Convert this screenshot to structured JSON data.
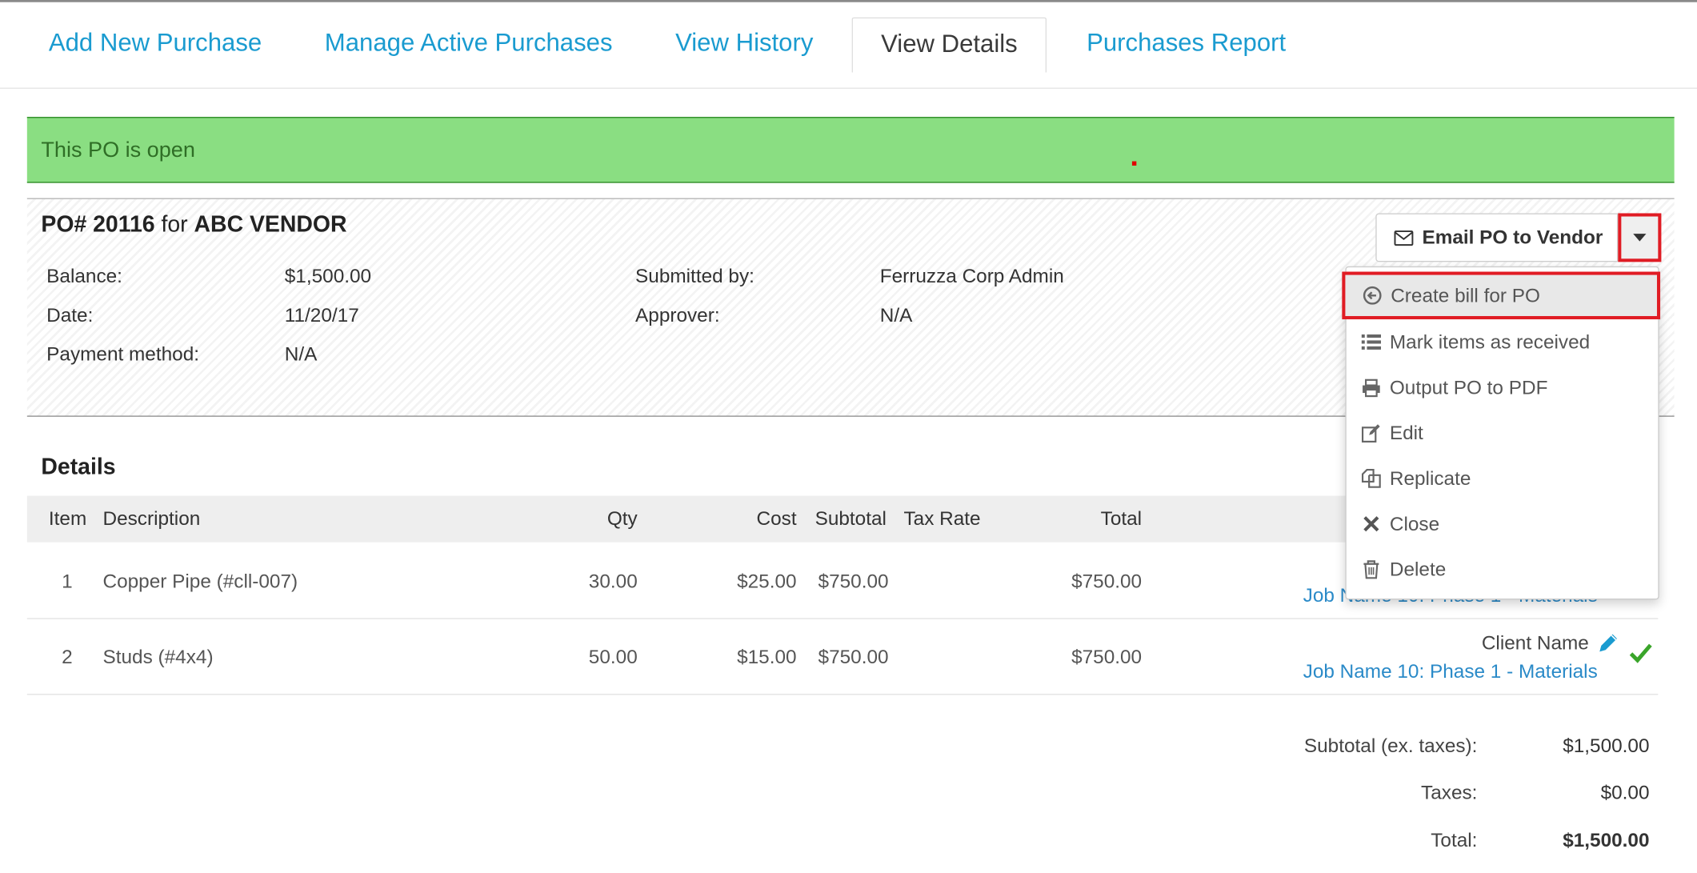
{
  "tabs": [
    {
      "label": "Add New Purchase"
    },
    {
      "label": "Manage Active Purchases"
    },
    {
      "label": "View History"
    },
    {
      "label": "View Details",
      "active": true
    },
    {
      "label": "Purchases Report"
    }
  ],
  "alert": {
    "text": "This PO is open",
    "color": "#8ade82"
  },
  "po": {
    "prefix": "PO# 20116",
    "for": "for",
    "vendor": "ABC VENDOR",
    "balance_label": "Balance:",
    "balance": "$1,500.00",
    "date_label": "Date:",
    "date": "11/20/17",
    "payment_label": "Payment method:",
    "payment": "N/A",
    "submitted_label": "Submitted by:",
    "submitted": "Ferruzza Corp Admin",
    "approver_label": "Approver:",
    "approver": "N/A"
  },
  "actions": {
    "email_label": "Email PO to Vendor",
    "menu": [
      {
        "label": "Create bill for PO",
        "icon": "arrow-circle-left-icon"
      },
      {
        "label": "Mark items as received",
        "icon": "list-icon"
      },
      {
        "label": "Output PO to PDF",
        "icon": "printer-icon"
      },
      {
        "label": "Edit",
        "icon": "edit-icon"
      },
      {
        "label": "Replicate",
        "icon": "copy-icon"
      },
      {
        "label": "Close",
        "icon": "x-icon"
      },
      {
        "label": "Delete",
        "icon": "trash-icon"
      }
    ]
  },
  "details": {
    "title": "Details",
    "headers": {
      "item": "Item",
      "description": "Description",
      "qty": "Qty",
      "cost": "Cost",
      "subtotal": "Subtotal",
      "tax_rate": "Tax Rate",
      "total": "Total"
    },
    "rows": [
      {
        "item": "1",
        "description": "Copper Pipe (#cll-007)",
        "qty": "30.00",
        "cost": "$25.00",
        "subtotal": "$750.00",
        "tax_rate": "",
        "total": "$750.00",
        "client": "",
        "job": "Job Name 10: Phase 1 - Materials"
      },
      {
        "item": "2",
        "description": "Studs (#4x4)",
        "qty": "50.00",
        "cost": "$15.00",
        "subtotal": "$750.00",
        "tax_rate": "",
        "total": "$750.00",
        "client": "Client Name",
        "job": "Job Name 10: Phase 1 - Materials"
      }
    ]
  },
  "summary": {
    "subtotal_label": "Subtotal (ex. taxes):",
    "subtotal": "$1,500.00",
    "taxes_label": "Taxes:",
    "taxes": "$0.00",
    "total_label": "Total:",
    "total": "$1,500.00"
  },
  "colors": {
    "link": "#1a9bd0",
    "alert_bg": "#8ade82",
    "highlight": "#e01c24",
    "check": "#3aa52a"
  }
}
